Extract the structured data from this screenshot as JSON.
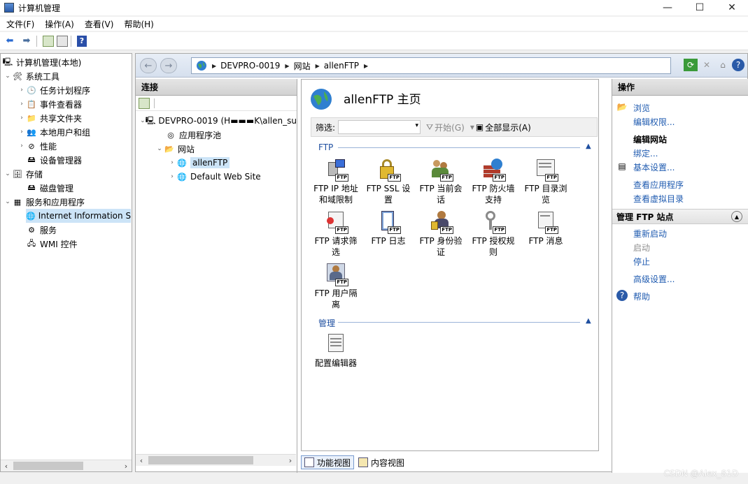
{
  "window": {
    "title": "计算机管理",
    "controls": [
      "—",
      "☐",
      "✕"
    ]
  },
  "menu": [
    "文件(F)",
    "操作(A)",
    "查看(V)",
    "帮助(H)"
  ],
  "left_tree": {
    "items": [
      {
        "label": "计算机管理(本地)",
        "icon": "computer-icon",
        "level": 0,
        "chev": ""
      },
      {
        "label": "系统工具",
        "icon": "tools-icon",
        "level": 1,
        "chev": "⌄"
      },
      {
        "label": "任务计划程序",
        "icon": "clock-icon",
        "level": 2,
        "chev": "›"
      },
      {
        "label": "事件查看器",
        "icon": "event-viewer-icon",
        "level": 2,
        "chev": "›"
      },
      {
        "label": "共享文件夹",
        "icon": "shared-folder-icon",
        "level": 2,
        "chev": "›"
      },
      {
        "label": "本地用户和组",
        "icon": "users-icon",
        "level": 2,
        "chev": "›"
      },
      {
        "label": "性能",
        "icon": "performance-icon",
        "level": 2,
        "chev": "›"
      },
      {
        "label": "设备管理器",
        "icon": "device-manager-icon",
        "level": 2,
        "chev": ""
      },
      {
        "label": "存储",
        "icon": "storage-icon",
        "level": 1,
        "chev": "⌄"
      },
      {
        "label": "磁盘管理",
        "icon": "disk-icon",
        "level": 2,
        "chev": ""
      },
      {
        "label": "服务和应用程序",
        "icon": "services-apps-icon",
        "level": 1,
        "chev": "⌄"
      },
      {
        "label": "Internet Information S",
        "icon": "iis-icon",
        "level": 2,
        "chev": ""
      },
      {
        "label": "服务",
        "icon": "gear-icon",
        "level": 2,
        "chev": ""
      },
      {
        "label": "WMI 控件",
        "icon": "wmi-icon",
        "level": 2,
        "chev": ""
      }
    ]
  },
  "address": {
    "crumbs": [
      "DEVPRO-0019",
      "网站",
      "allenFTP"
    ]
  },
  "connections": {
    "title": "连接",
    "items": [
      {
        "label": "DEVPRO-0019 (H▬▬▬K\\allen_su",
        "level": 0,
        "chev": "⌄",
        "icon": "server-icon"
      },
      {
        "label": "应用程序池",
        "level": 1,
        "chev": "",
        "icon": "app-pool-icon"
      },
      {
        "label": "网站",
        "level": 1,
        "chev": "⌄",
        "icon": "sites-folder-icon"
      },
      {
        "label": "allenFTP",
        "level": 2,
        "chev": "›",
        "icon": "globe-icon",
        "selected": true
      },
      {
        "label": "Default Web Site",
        "level": 2,
        "chev": "›",
        "icon": "website-icon"
      }
    ]
  },
  "center": {
    "title": "allenFTP 主页",
    "filter_label": "筛选:",
    "start_label": "开始(G)",
    "showall_label": "全部显示(A)",
    "group_ftp": "FTP",
    "group_manage": "管理",
    "features_row1": [
      {
        "l1": "FTP IP 地址",
        "l2": "和域限制",
        "icon": "ftp-ip-restrict-icon"
      },
      {
        "l1": "FTP SSL 设",
        "l2": "置",
        "icon": "ftp-ssl-lock-icon"
      },
      {
        "l1": "FTP 当前会",
        "l2": "话",
        "icon": "ftp-sessions-icon"
      },
      {
        "l1": "FTP 防火墙",
        "l2": "支持",
        "icon": "ftp-firewall-icon"
      },
      {
        "l1": "FTP 目录浏",
        "l2": "览",
        "icon": "ftp-directory-icon"
      }
    ],
    "features_row2": [
      {
        "l1": "FTP 请求筛",
        "l2": "选",
        "icon": "ftp-request-filter-icon"
      },
      {
        "l1": "FTP 日志",
        "l2": "",
        "icon": "ftp-logging-icon"
      },
      {
        "l1": "FTP 身份验",
        "l2": "证",
        "icon": "ftp-auth-icon"
      },
      {
        "l1": "FTP 授权规",
        "l2": "则",
        "icon": "ftp-authz-key-icon"
      },
      {
        "l1": "FTP 消息",
        "l2": "",
        "icon": "ftp-messages-icon"
      }
    ],
    "features_row3": [
      {
        "l1": "FTP 用户隔",
        "l2": "离",
        "icon": "ftp-user-isolation-icon"
      }
    ],
    "manage_items": [
      {
        "l1": "配置编辑器",
        "icon": "config-editor-icon"
      }
    ],
    "tag": "FTP"
  },
  "view_tabs": {
    "features": "功能视图",
    "content": "内容视图"
  },
  "actions": {
    "title": "操作",
    "browse": "浏览",
    "edit_perm": "编辑权限...",
    "edit_site": "编辑网站",
    "bindings": "绑定...",
    "basic": "基本设置...",
    "view_apps": "查看应用程序",
    "view_vdirs": "查看虚拟目录",
    "manage_title": "管理 FTP 站点",
    "restart": "重新启动",
    "start": "启动",
    "stop": "停止",
    "advanced": "高级设置...",
    "help": "帮助"
  },
  "watermark": "CSDN @Alex_81D",
  "colors": {
    "link": "#1f5bb0",
    "selected": "#cce4f7",
    "header": "#d2d2d2"
  }
}
